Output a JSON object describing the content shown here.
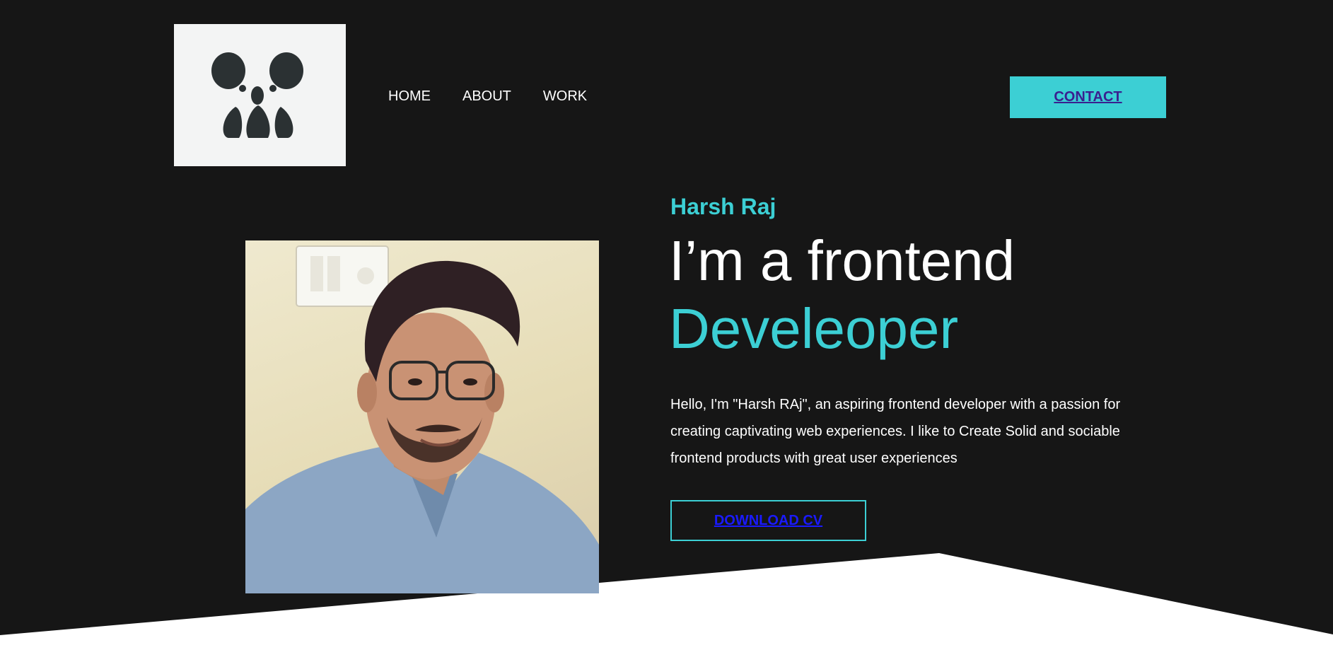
{
  "colors": {
    "background": "#161616",
    "accent": "#3ccfd4",
    "text": "#ffffff",
    "logo_bg": "#f3f4f4",
    "logo_fg": "#2b3133"
  },
  "logo": {
    "icon": "koala-icon"
  },
  "nav": {
    "items": [
      {
        "label": "HOME"
      },
      {
        "label": "ABOUT"
      },
      {
        "label": "WORK"
      }
    ],
    "contact_label": "CONTACT"
  },
  "hero": {
    "name": "Harsh Raj",
    "headline_line1": "I’m a frontend",
    "headline_line2": "Develeoper",
    "intro": "Hello, I'm \"Harsh RAj\", an aspiring frontend developer with a passion for creating captivating web experiences. I like to Create Solid and sociable frontend products with great user experiences",
    "download_label": "DOWNLOAD CV",
    "photo": "profile-photo"
  }
}
